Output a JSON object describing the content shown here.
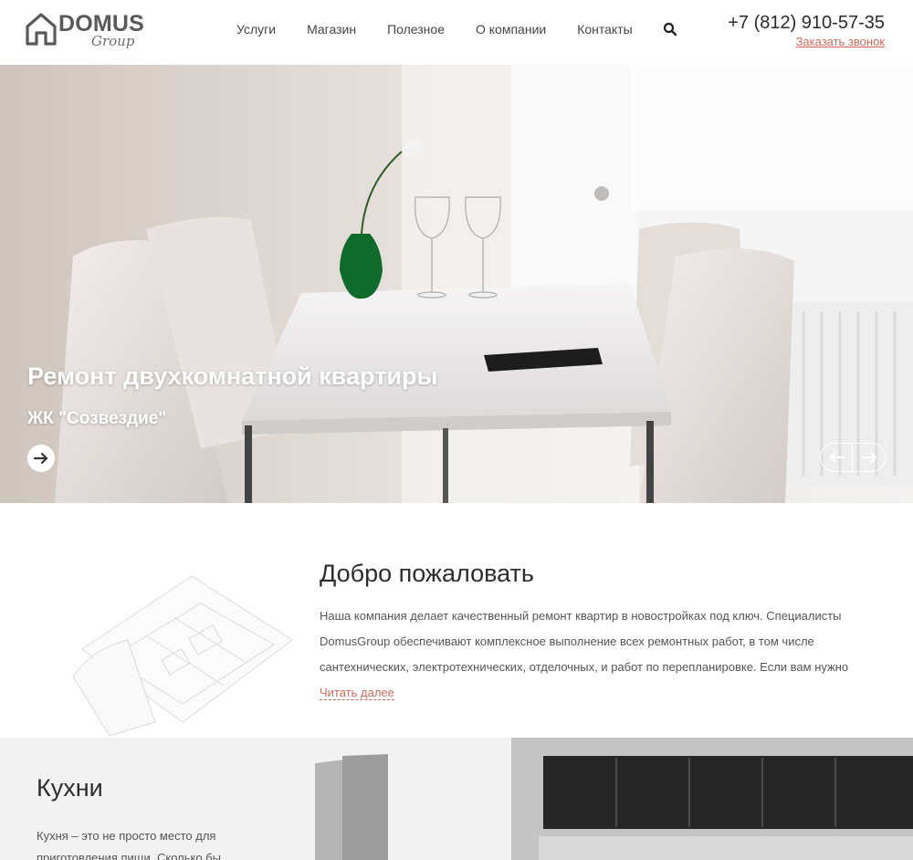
{
  "header": {
    "logo_word": "DOMUS",
    "logo_sub": "Group",
    "nav": [
      {
        "label": "Услуги"
      },
      {
        "label": "Магазин"
      },
      {
        "label": "Полезное"
      },
      {
        "label": "О компании"
      },
      {
        "label": "Контакты"
      }
    ],
    "search_icon": "search-icon",
    "phone": "+7 (812) 910-57-35",
    "callback": "Заказать звонок"
  },
  "hero": {
    "title": "Ремонт двухкомнатной квартиры",
    "subtitle": "ЖК \"Созвездие\"",
    "go_icon": "arrow-right-icon",
    "prev_icon": "arrow-left-icon",
    "next_icon": "arrow-right-icon"
  },
  "welcome": {
    "title": "Добро пожаловать",
    "text": "Наша компания делает качественный ремонт квартир в новостройках под ключ. Специалисты DomusGroup обеспечивают комплексное выполнение всех ремонтных работ, в том числе сантехнических, электротехнических, отделочных, и работ по перепланировке. Если вам нужно",
    "read_more": "Читать далее"
  },
  "kitchen": {
    "title": "Кухни",
    "text": "Кухня – это не просто место для приготовления пищи. Сколько бы"
  },
  "colors": {
    "accent": "#d06a5a",
    "text_dark": "#2d2d2d",
    "text_body": "#555555"
  }
}
